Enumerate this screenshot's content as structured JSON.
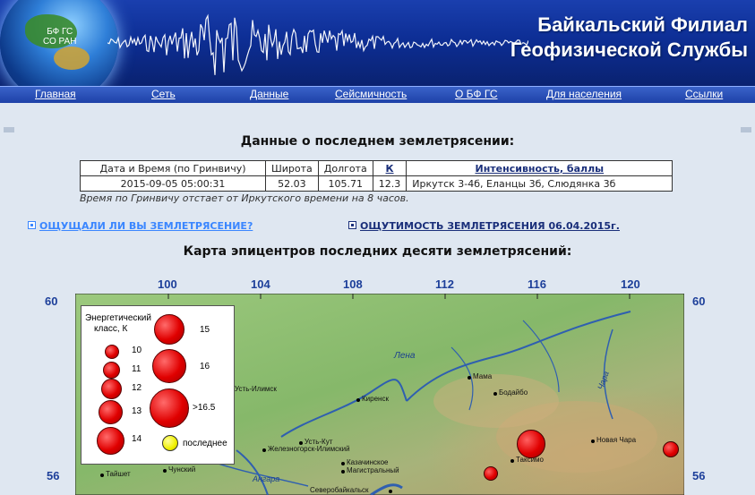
{
  "header": {
    "globe_line1": "БФ ГС",
    "globe_line2": "СО РАН",
    "title_line1": "Байкальский Филиал",
    "title_line2": "Геофизической Службы"
  },
  "nav": {
    "items": [
      "Главная",
      "Сеть",
      "Данные",
      "Сейсмичность",
      "О БФ ГС",
      "Для населения",
      "Ссылки"
    ]
  },
  "main": {
    "heading": "Данные о последнем землетрясении:",
    "table": {
      "headers": [
        "Дата и Время (по Гринвичу)",
        "Широта",
        "Долгота",
        "К",
        "Интенсивность, баллы"
      ],
      "row": [
        "2015-09-05 05:00:31",
        "52.03",
        "105.71",
        "12.3",
        "Иркутск 3-4б, Еланцы 3б, Слюдянка 3б"
      ]
    },
    "note": "Время по Гринвичу отстает от Иркутского времени на 8 часов.",
    "link_felt": "ОЩУЩАЛИ ЛИ ВЫ ЗЕМЛЕТРЯСЕНИЕ?",
    "link_felt_color": "#3a86ff",
    "link_intensity": "ОЩУТИМОСТЬ ЗЕМЛЕТРЯСЕНИЯ 06.04.2015г.",
    "link_intensity_color": "#1a2f7a",
    "map_title": "Карта эпицентров последних десяти землетрясений:"
  },
  "map": {
    "lon_labels": [
      "100",
      "104",
      "108",
      "112",
      "116",
      "120"
    ],
    "lat_labels": [
      "60",
      "60",
      "56",
      "56"
    ],
    "legend": {
      "title_line1": "Энергетический",
      "title_line2": "класс, К",
      "classes": [
        "10",
        "11",
        "12",
        "13",
        "14",
        "15",
        "16",
        ">16.5"
      ],
      "last_label": "последнее"
    },
    "places": [
      "Лена",
      "Усть-Илимск",
      "Киренск",
      "Мама",
      "Бодайбо",
      "Чара",
      "Усть-Кут",
      "Железногорск-Илимский",
      "Новая Чара",
      "Таксимо",
      "Казачинское",
      "Магистральный",
      "Северобайкальск",
      "Тайшет",
      "Чунский",
      "Ангара"
    ],
    "colors": {
      "quake": "#e00000",
      "last": "#f0f000"
    }
  }
}
